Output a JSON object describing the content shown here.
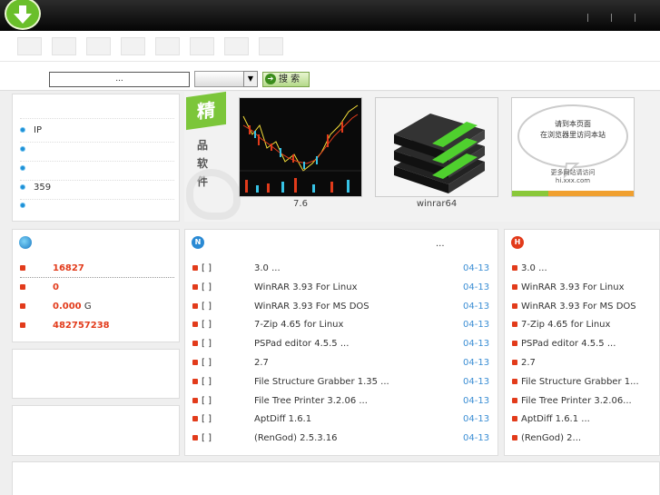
{
  "header": {
    "logo_icon": "download-arrow-icon",
    "top_links": "| | |"
  },
  "nav": {
    "tabs": [
      "",
      "",
      "",
      "",
      "",
      "",
      "",
      ""
    ]
  },
  "search": {
    "input_value": "...",
    "select_value": "",
    "button_label": "搜 索"
  },
  "sidebar": {
    "items": [
      {
        "label": "",
        "value": ""
      },
      {
        "label": "IP",
        "value": ""
      },
      {
        "label": "",
        "value": ""
      },
      {
        "label": "",
        "value": ""
      },
      {
        "label": "359",
        "value": ""
      },
      {
        "label": "",
        "value": ""
      }
    ]
  },
  "featured": {
    "badge": "精",
    "vertical_text": [
      "品",
      "软",
      "件"
    ],
    "items": [
      {
        "caption": "7.6",
        "icon": "stock-chart-image"
      },
      {
        "caption": "winrar64",
        "icon": "winrar-books-image"
      },
      {
        "caption": "",
        "icon": "site-logo-image",
        "thumb_text1": "请到本页面",
        "thumb_text2": "在浏览器里访问本站",
        "thumb_text3": "更多网站请访问",
        "thumb_text4": "hi.xxx.com"
      }
    ]
  },
  "stats": {
    "icon": "globe-icon",
    "rows": [
      {
        "value": "16827",
        "unit": ""
      },
      {
        "value": "0",
        "unit": ""
      },
      {
        "value": "0.000",
        "unit": "G"
      },
      {
        "value": "482757238",
        "unit": ""
      }
    ]
  },
  "news": {
    "icon": "new-badge-icon",
    "more": "...",
    "rows": [
      {
        "tag": "[    ]",
        "title": "3.0        ...",
        "date": "04-13"
      },
      {
        "tag": "[    ]",
        "title": "WinRAR 3.93 For Linux",
        "date": "04-13"
      },
      {
        "tag": "[    ]",
        "title": "WinRAR 3.93 For MS DOS",
        "date": "04-13"
      },
      {
        "tag": "[    ]",
        "title": "7-Zip 4.65 for Linux",
        "date": "04-13"
      },
      {
        "tag": "[    ]",
        "title": "PSPad editor 4.5.5        ...",
        "date": "04-13"
      },
      {
        "tag": "[    ]",
        "title": "2.7",
        "date": "04-13"
      },
      {
        "tag": "[    ]",
        "title": "File Structure Grabber 1.35      ...",
        "date": "04-13"
      },
      {
        "tag": "[    ]",
        "title": "File Tree Printer 3.2.06      ...",
        "date": "04-13"
      },
      {
        "tag": "[    ]",
        "title": "AptDiff 1.6.1",
        "date": "04-13"
      },
      {
        "tag": "[    ]",
        "title": "(RenGod) 2.5.3.16",
        "date": "04-13"
      }
    ]
  },
  "hot": {
    "icon": "hot-badge-icon",
    "rows": [
      "3.0      ...",
      "WinRAR 3.93 For Linux",
      "WinRAR 3.93 For MS DOS",
      "7-Zip 4.65 for Linux",
      "PSPad editor 4.5.5    ...",
      "2.7",
      "File Structure Grabber 1...",
      "File Tree Printer 3.2.06...",
      "AptDiff 1.6.1        ...",
      "(RenGod) 2..."
    ]
  }
}
